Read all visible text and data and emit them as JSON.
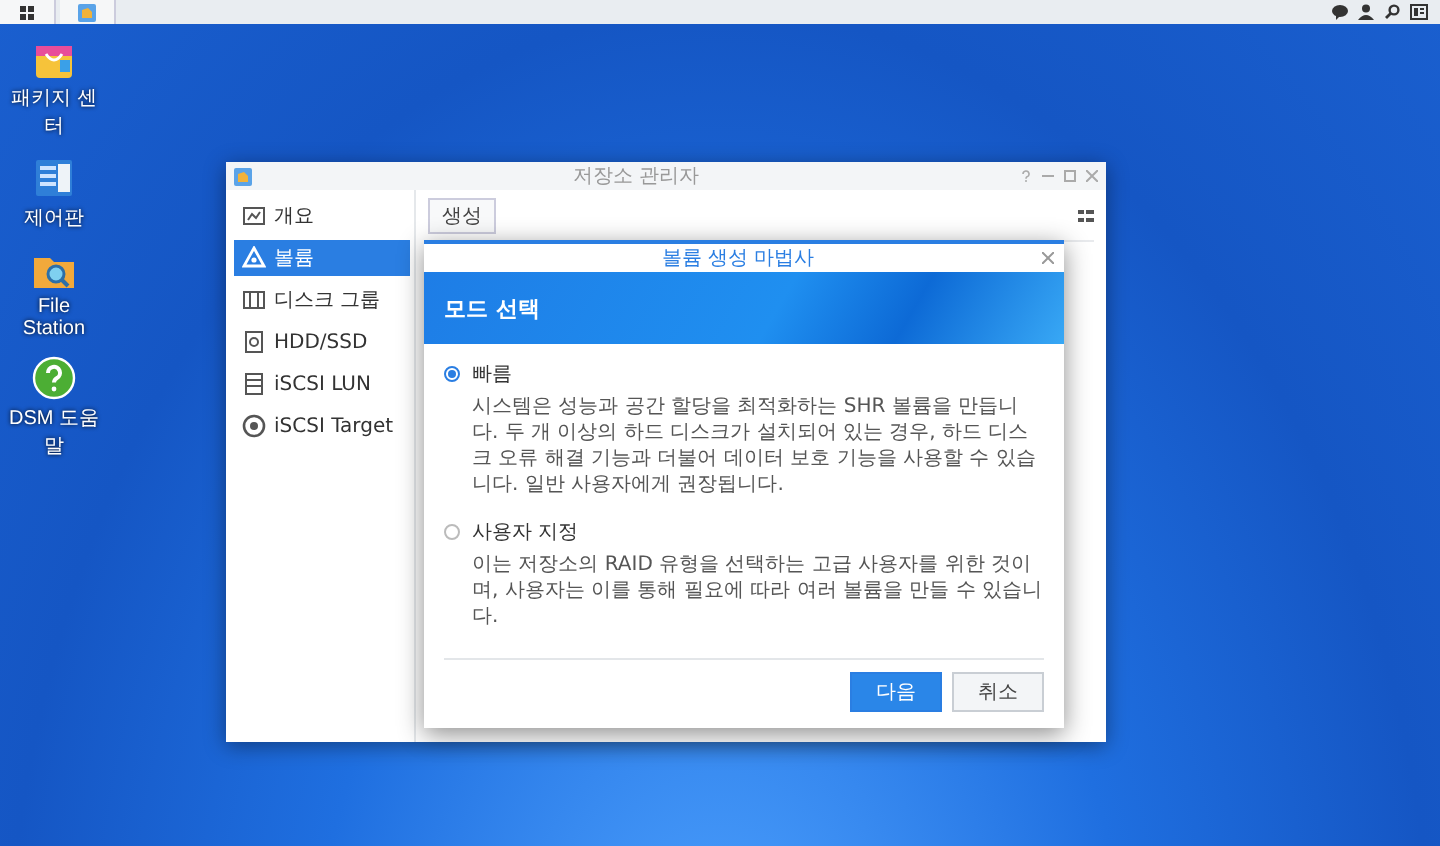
{
  "desktop_icons": [
    {
      "label": "패키지 센터",
      "kind": "package"
    },
    {
      "label": "제어판",
      "kind": "panel"
    },
    {
      "label": "File Station",
      "kind": "folder"
    },
    {
      "label": "DSM 도움말",
      "kind": "help"
    }
  ],
  "window": {
    "title": "저장소 관리자",
    "sidebar": [
      {
        "label": "개요",
        "selected": false,
        "kind": "overview"
      },
      {
        "label": "볼륨",
        "selected": true,
        "kind": "volume"
      },
      {
        "label": "디스크 그룹",
        "selected": false,
        "kind": "group"
      },
      {
        "label": "HDD/SSD",
        "selected": false,
        "kind": "disk"
      },
      {
        "label": "iSCSI LUN",
        "selected": false,
        "kind": "lun"
      },
      {
        "label": "iSCSI Target",
        "selected": false,
        "kind": "target"
      }
    ],
    "toolbar_button": "생성"
  },
  "dialog": {
    "title": "볼륨 생성 마법사",
    "header": "모드 선택",
    "options": [
      {
        "label": "빠름",
        "selected": true,
        "description": "시스템은 성능과 공간 할당을 최적화하는 SHR 볼륨을 만듭니다. 두 개 이상의 하드 디스크가 설치되어 있는 경우, 하드 디스크 오류 해결 기능과 더불어 데이터 보호 기능을 사용할 수 있습니다. 일반 사용자에게 권장됩니다."
      },
      {
        "label": "사용자 지정",
        "selected": false,
        "description": "이는 저장소의 RAID 유형을 선택하는 고급 사용자를 위한 것이며, 사용자는 이를 통해 필요에 따라 여러 볼륨을 만들 수 있습니다."
      }
    ],
    "buttons": [
      {
        "label": "다음",
        "kind": "primary"
      },
      {
        "label": "취소",
        "kind": "secondary"
      }
    ]
  }
}
